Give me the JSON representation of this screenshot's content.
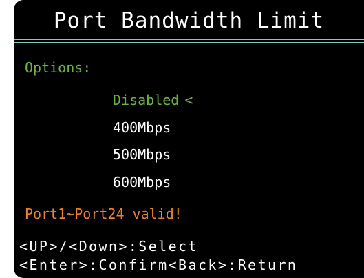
{
  "screen": {
    "title": "Port Bandwidth Limit",
    "options_label": "Options:",
    "options": [
      {
        "label": "Disabled",
        "selected": true,
        "marker": "<"
      },
      {
        "label": "400Mbps",
        "selected": false,
        "marker": ""
      },
      {
        "label": "500Mbps",
        "selected": false,
        "marker": ""
      },
      {
        "label": "600Mbps",
        "selected": false,
        "marker": ""
      }
    ],
    "status_message": "Port1~Port24 valid!",
    "help": {
      "line1": "<UP>/<Down>:Select",
      "line2": "<Enter>:Confirm<Back>:Return"
    }
  },
  "colors": {
    "background": "#000000",
    "title_text": "#ffffff",
    "rule": "#7fc8c8",
    "label_green": "#6db33f",
    "warning_orange": "#f07f2f"
  }
}
